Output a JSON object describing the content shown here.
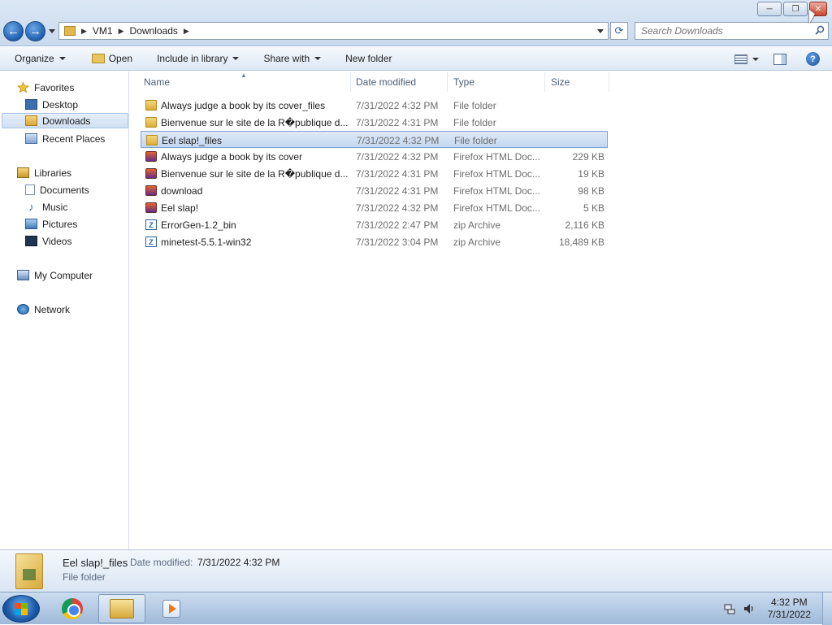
{
  "window": {
    "minimize_label": "─",
    "maximize_label": "❐",
    "close_label": "✕"
  },
  "nav": {
    "back_glyph": "←",
    "forward_glyph": "→"
  },
  "address": {
    "crumbs": [
      "VM1",
      "Downloads"
    ],
    "refresh_glyph": "⟳"
  },
  "search": {
    "placeholder": "Search Downloads"
  },
  "commandbar": {
    "organize": "Organize",
    "open": "Open",
    "include_in_library": "Include in library",
    "share_with": "Share with",
    "new_folder": "New folder",
    "help_glyph": "?"
  },
  "sidebar": {
    "favorites": "Favorites",
    "desktop": "Desktop",
    "downloads": "Downloads",
    "recent_places": "Recent Places",
    "libraries": "Libraries",
    "documents": "Documents",
    "music": "Music",
    "pictures": "Pictures",
    "videos": "Videos",
    "my_computer": "My Computer",
    "network": "Network"
  },
  "columns": {
    "name": "Name",
    "date_modified": "Date modified",
    "type": "Type",
    "size": "Size",
    "sort_glyph": "▲"
  },
  "files": [
    {
      "name": "Always judge a book by its cover_files",
      "date": "7/31/2022 4:32 PM",
      "type": "File folder",
      "size": "",
      "icon": "folder-icon"
    },
    {
      "name": "Bienvenue sur le site de la R�publique d...",
      "date": "7/31/2022 4:31 PM",
      "type": "File folder",
      "size": "",
      "icon": "folder-icon"
    },
    {
      "name": "Eel slap!_files",
      "date": "7/31/2022 4:32 PM",
      "type": "File folder",
      "size": "",
      "icon": "folder-icon",
      "selected": true
    },
    {
      "name": "Always judge a book by its cover",
      "date": "7/31/2022 4:32 PM",
      "type": "Firefox HTML Doc...",
      "size": "229 KB",
      "icon": "firefox-html-icon"
    },
    {
      "name": "Bienvenue sur le site de la R�publique d...",
      "date": "7/31/2022 4:31 PM",
      "type": "Firefox HTML Doc...",
      "size": "19 KB",
      "icon": "firefox-html-icon"
    },
    {
      "name": "download",
      "date": "7/31/2022 4:31 PM",
      "type": "Firefox HTML Doc...",
      "size": "98 KB",
      "icon": "firefox-html-icon"
    },
    {
      "name": "Eel slap!",
      "date": "7/31/2022 4:32 PM",
      "type": "Firefox HTML Doc...",
      "size": "5 KB",
      "icon": "firefox-html-icon"
    },
    {
      "name": "ErrorGen-1.2_bin",
      "date": "7/31/2022 2:47 PM",
      "type": "zip Archive",
      "size": "2,116 KB",
      "icon": "zip-archive-icon"
    },
    {
      "name": "minetest-5.5.1-win32",
      "date": "7/31/2022 3:04 PM",
      "type": "zip Archive",
      "size": "18,489 KB",
      "icon": "zip-archive-icon"
    }
  ],
  "details": {
    "name": "Eel slap!_files",
    "date_label": "Date modified:",
    "date_value": "7/31/2022 4:32 PM",
    "type": "File folder"
  },
  "taskbar": {
    "clock_time": "4:32 PM",
    "clock_date": "7/31/2022"
  },
  "colors": {
    "selection": "#cfdff2",
    "accent": "#1f5fad"
  }
}
